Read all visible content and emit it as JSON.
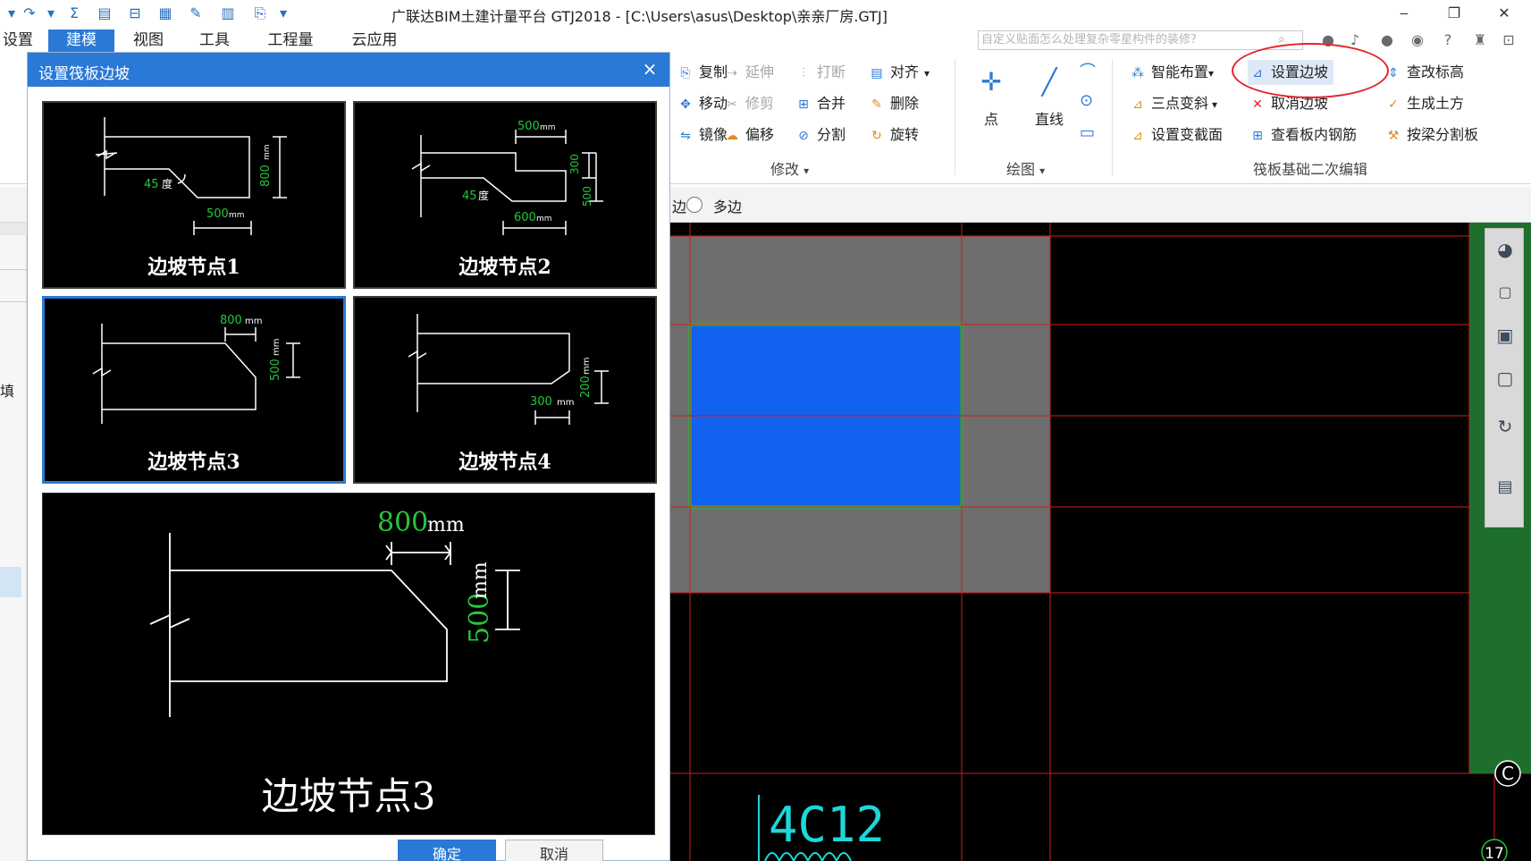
{
  "app": {
    "title": "广联达BIM土建计量平台 GTJ2018 - [C:\\Users\\asus\\Desktop\\亲亲厂房.GTJ]"
  },
  "menu": {
    "tabs": [
      "设置",
      "建模",
      "视图",
      "工具",
      "工程量",
      "云应用"
    ],
    "active_tab": "建模",
    "search_placeholder": "自定义贴面怎么处理复杂零星构件的装修?"
  },
  "ribbon": {
    "modify": {
      "copy": "复制",
      "extend": "延伸",
      "break": "打断",
      "align": "对齐",
      "move": "移动",
      "trim": "修剪",
      "merge": "合并",
      "delete": "删除",
      "mirror": "镜像",
      "offset": "偏移",
      "split": "分割",
      "rotate": "旋转",
      "label": "修改"
    },
    "draw": {
      "point": "点",
      "line": "直线",
      "label": "绘图"
    },
    "raft": {
      "smart_layout": "智能布置",
      "set_slope": "设置边坡",
      "check_elevation": "查改标高",
      "three_point_slope": "三点变斜",
      "cancel_slope": "取消边坡",
      "gen_earthwork": "生成土方",
      "set_variable_section": "设置变截面",
      "view_inner_rebar": "查看板内钢筋",
      "split_by_beam": "按梁分割板",
      "label": "筏板基础二次编辑"
    }
  },
  "optbar": {
    "edge_label": "边",
    "multi_edge_label": "多边",
    "left_partial": "填"
  },
  "dialog": {
    "title": "设置筏板边坡",
    "close_glyph": "×",
    "nodes": [
      {
        "caption": "边坡节点1",
        "angle": "45",
        "angle_unit": "度",
        "dim_a": "800",
        "dim_b": "500",
        "unit": "mm"
      },
      {
        "caption": "边坡节点2",
        "angle": "45",
        "angle_unit": "度",
        "dim_top": "500",
        "dim_v1": "300",
        "dim_v2": "500",
        "dim_bottom": "600",
        "unit": "mm"
      },
      {
        "caption": "边坡节点3",
        "dim_h": "800",
        "dim_v": "500",
        "unit": "mm"
      },
      {
        "caption": "边坡节点4",
        "dim_h": "300",
        "dim_v": "200",
        "unit": "mm"
      }
    ],
    "selected_index": 2,
    "preview": {
      "caption": "边坡节点3",
      "dim_h": "800",
      "dim_v": "500",
      "unit": "mm"
    },
    "ok_label": "确定",
    "cancel_label": "取消"
  },
  "canvas": {
    "label_bottom": "4C12",
    "axis_c": "C",
    "axis_17": "17"
  },
  "colors": {
    "accent": "#2b79d6",
    "cad_green": "#22c83a",
    "annotation_red": "#e2232a",
    "slab_blue": "#1262f0",
    "cyan": "#1ed7d7"
  }
}
